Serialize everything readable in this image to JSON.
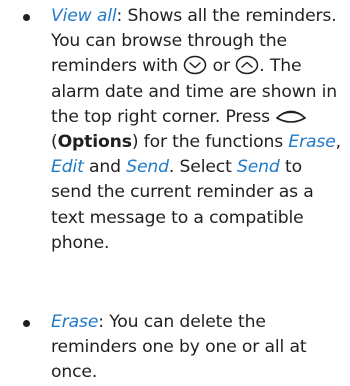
{
  "colors": {
    "text": "#231f20",
    "link": "#1f7ac8"
  },
  "items": [
    {
      "term": "View all",
      "parts": {
        "a": ": Shows all the reminders. You can browse through the reminders with ",
        "b": " or ",
        "c": ". The alarm date and time are shown in the top right corner. Press ",
        "d": " (",
        "options_label": "Options",
        "e": ") for the functions ",
        "func_erase": "Erase",
        "f": ", ",
        "func_edit": "Edit",
        "g": " and ",
        "func_send": "Send",
        "h": ". Select ",
        "select_send": "Send",
        "i": " to send the current reminder as a text message to a compatible phone."
      },
      "icons": [
        "scroll-down-key-icon",
        "scroll-up-key-icon",
        "selection-key-icon"
      ]
    },
    {
      "term": "Erase",
      "description": ": You can delete the reminders one by one or all at once."
    }
  ]
}
